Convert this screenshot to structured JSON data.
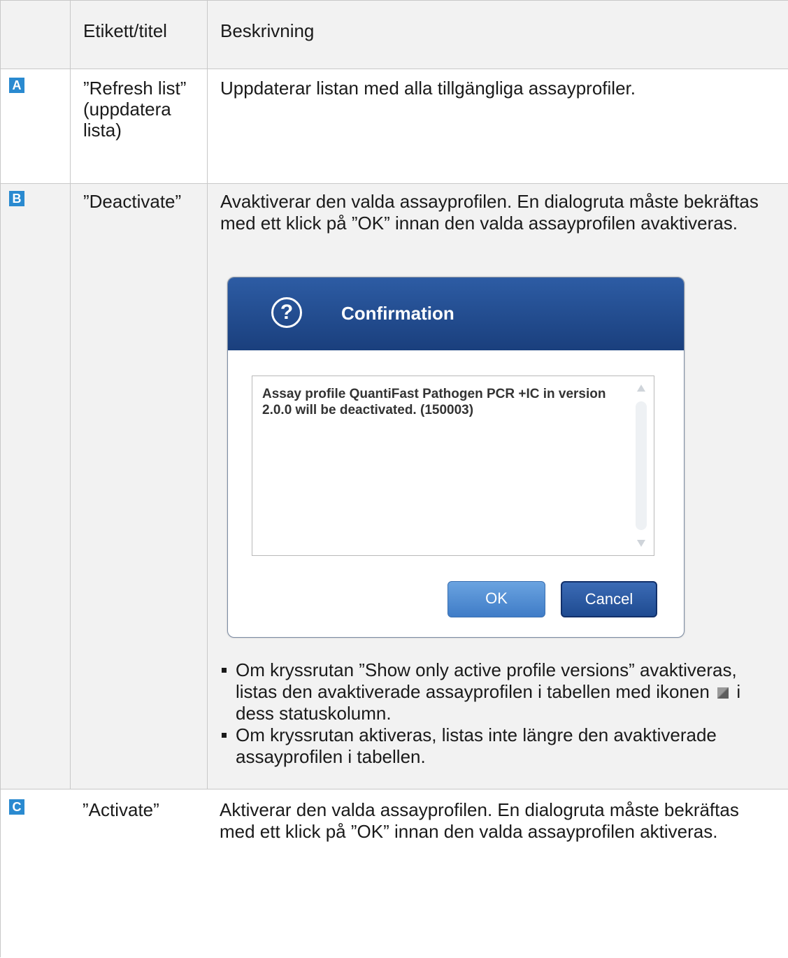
{
  "header": {
    "col1": "",
    "col2": "Etikett/titel",
    "col3": "Beskrivning"
  },
  "rows": [
    {
      "badge": "A",
      "label": "”Refresh list” (uppdatera lista)",
      "description": "Uppdaterar listan med alla tillgängliga assayprofiler."
    },
    {
      "badge": "B",
      "label": "”Deactivate”",
      "description": "Avaktiverar den valda assayprofilen. En dialogruta måste bekräftas med ett klick på ”OK” innan den valda assayprofilen avaktiveras.",
      "dialog": {
        "title": "Confirmation",
        "question_icon": "?",
        "message": "Assay profile QuantiFast Pathogen PCR +IC in version 2.0.0 will be deactivated. (150003)",
        "ok_label": "OK",
        "cancel_label": "Cancel"
      },
      "bullets": [
        {
          "before_icon": "Om kryssrutan ”Show only active profile versions” avaktiveras, listas den avaktiverade assayprofilen i tabellen med ikonen",
          "after_icon": "i dess statuskolumn."
        },
        {
          "text": "Om kryssrutan aktiveras, listas inte längre den avaktiverade assayprofilen i tabellen."
        }
      ],
      "status_icon": "deactivated-status-icon"
    },
    {
      "badge": "C",
      "label": "”Activate”",
      "description": "Aktiverar den valda assayprofilen. En dialogruta måste bekräftas med ett klick på ”OK” innan den valda assayprofilen aktiveras."
    }
  ],
  "colors": {
    "badge": "#2a8ad0",
    "shade": "#f2f2f2",
    "dialog_header": "#2d5ca4"
  }
}
